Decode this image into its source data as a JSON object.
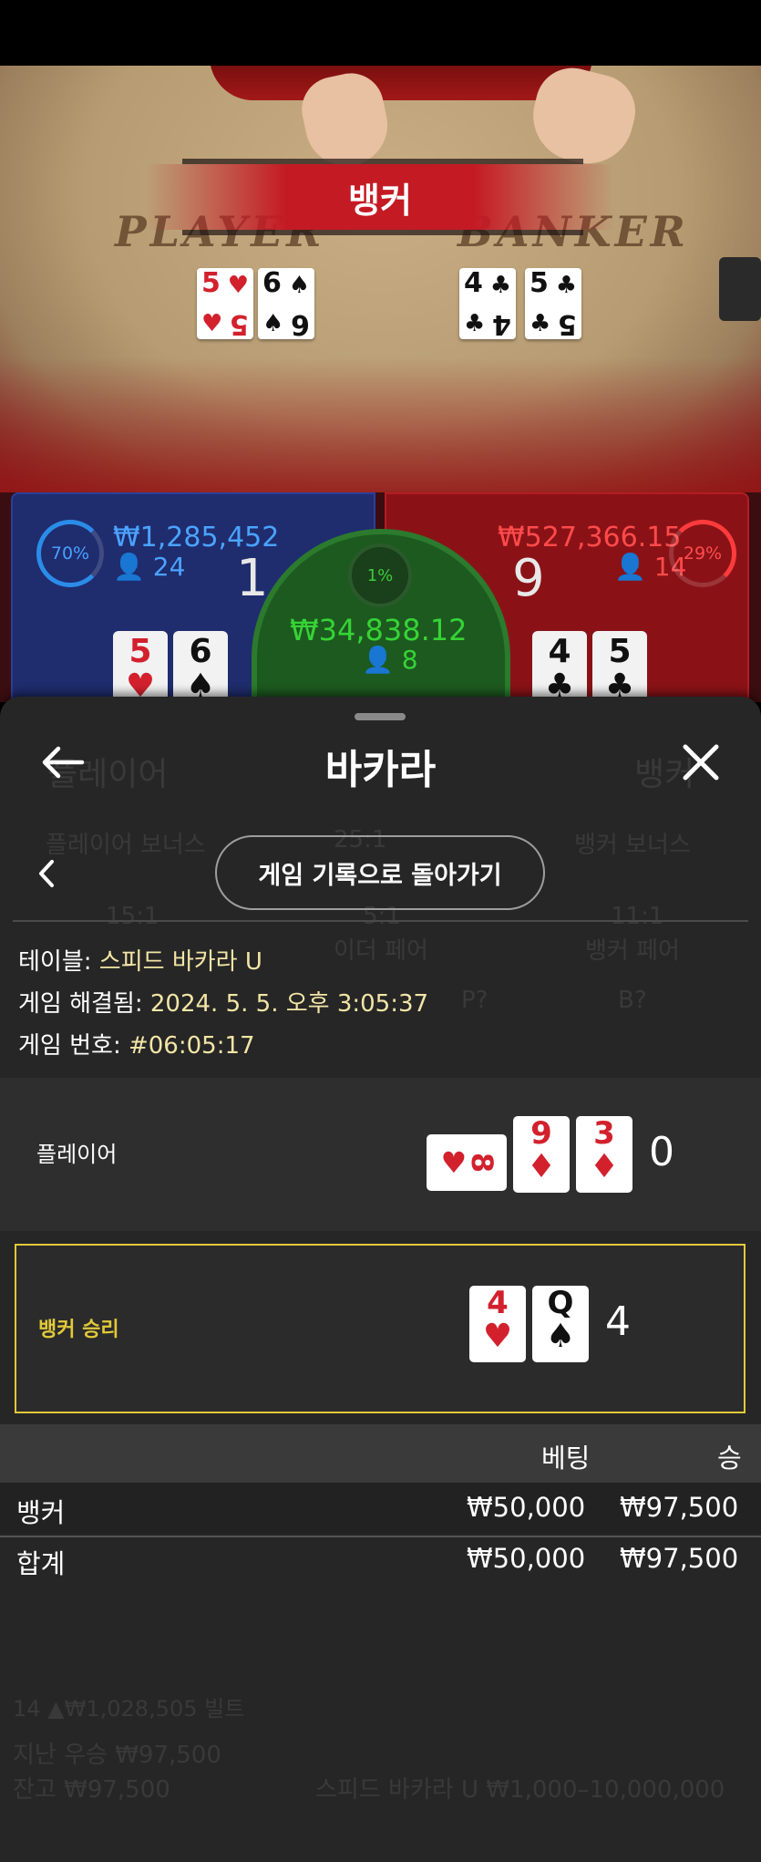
{
  "table": {
    "player_word": "PLAYER",
    "banker_word": "BANKER",
    "winner_banner": "뱅커",
    "player_cards": [
      {
        "rank": "5",
        "suit": "♥",
        "color": "#d2212d"
      },
      {
        "rank": "6",
        "suit": "♠",
        "color": "#111111"
      }
    ],
    "banker_cards": [
      {
        "rank": "4",
        "suit": "♣",
        "color": "#111111"
      },
      {
        "rank": "5",
        "suit": "♣",
        "color": "#111111"
      }
    ]
  },
  "stats": {
    "player": {
      "percent": "70%",
      "amount": "₩1,285,452",
      "count": "24",
      "score": "1",
      "cards": [
        {
          "rank": "5",
          "suit": "♥",
          "color": "#d2212d"
        },
        {
          "rank": "6",
          "suit": "♠",
          "color": "#111111"
        }
      ]
    },
    "tie": {
      "percent": "1%",
      "amount": "₩34,838.12",
      "count": "8"
    },
    "banker": {
      "percent": "29%",
      "amount": "₩527,366.15",
      "count": "14",
      "score": "9",
      "cards": [
        {
          "rank": "4",
          "suit": "♣",
          "color": "#111111"
        },
        {
          "rank": "5",
          "suit": "♣",
          "color": "#111111"
        }
      ]
    }
  },
  "background_bet_ui": {
    "player_label": "플레이어",
    "banker_label": "뱅커",
    "player_bonus": "플레이어 보너스",
    "banker_bonus": "뱅커 보너스",
    "odds_center": "25:1",
    "odds_left": "15:1",
    "odds_mid": "5:1",
    "odds_right": "11:1",
    "either_pair": "이더 페어",
    "banker_pair": "뱅커 페어",
    "p_ask": "P?",
    "b_ask": "B?",
    "footer_line1": "14 ▲₩1,028,505 빌트",
    "footer_last_win": "지난 우승 ₩97,500",
    "footer_balance": "잔고 ₩97,500",
    "footer_limits": "스피드 바카라 U  ₩1,000–10,000,000"
  },
  "sheet": {
    "title": "바카라",
    "back_to_history": "게임 기록으로 돌아가기",
    "info": [
      {
        "label": "테이블: ",
        "value": "스피드 바카라 U"
      },
      {
        "label": "게임 해결됨: ",
        "value": "2024. 5. 5. 오후 3:05:37"
      },
      {
        "label": "게임 번호: ",
        "value": "#06:05:17"
      }
    ],
    "player_row": {
      "label": "플레이어",
      "side_card": {
        "rank": "8",
        "suit": "♥",
        "color": "#d2212d"
      },
      "cards": [
        {
          "rank": "9",
          "suit": "♦",
          "color": "#d2212d"
        },
        {
          "rank": "3",
          "suit": "♦",
          "color": "#d2212d"
        }
      ],
      "total": "0"
    },
    "banker_row": {
      "label": "뱅커 승리",
      "label_color": "#e2c93a",
      "cards": [
        {
          "rank": "4",
          "suit": "♥",
          "color": "#d2212d"
        },
        {
          "rank": "Q",
          "suit": "♠",
          "color": "#111111"
        }
      ],
      "total": "4"
    },
    "bets_table": {
      "headers": [
        "베팅",
        "승"
      ],
      "rows": [
        {
          "name": "뱅커",
          "bet": "₩50,000",
          "win": "₩97,500"
        }
      ],
      "total": {
        "name": "합계",
        "bet": "₩50,000",
        "win": "₩97,500"
      }
    }
  },
  "colors": {
    "player_blue": "#4aa3ff",
    "banker_red": "#ff4a4a",
    "tie_green": "#36d336",
    "highlight_yellow": "#e2c93a",
    "value_cream": "#f2e5a6"
  }
}
